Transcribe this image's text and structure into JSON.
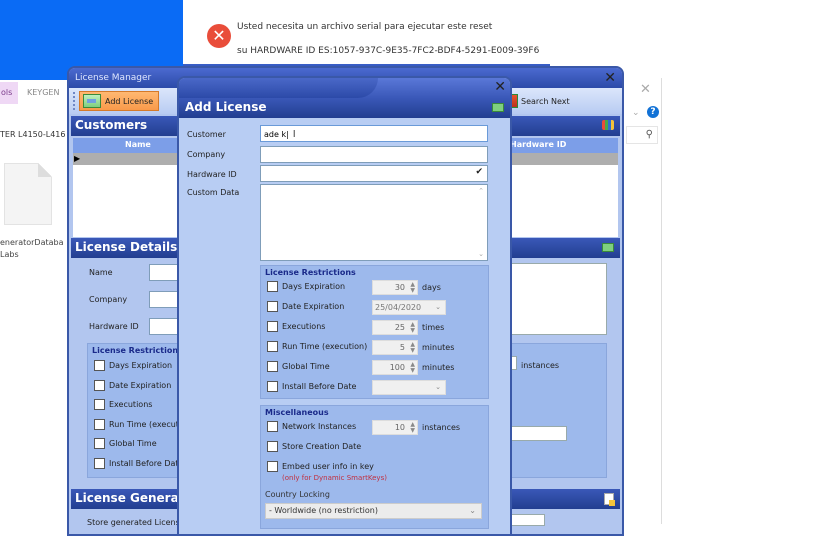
{
  "error_dialog": {
    "line1": "Usted necesita un archivo serial para ejecutar este reset",
    "line2": "su HARDWARE ID ES:1057-937C-9E35-7FC2-BDF4-5291-E009-39F6",
    "icon": "error-icon"
  },
  "explorer": {
    "tab_tools": "ols",
    "tab_keygen": "KEYGEN",
    "address": "TER L4150-L416",
    "file_name_line1": "eneratorDataba",
    "file_name_line2": "Labs"
  },
  "license_manager": {
    "title": "License Manager",
    "toolbar": {
      "add_license": "Add License",
      "search_next": "Search Next"
    },
    "customers": {
      "title": "Customers",
      "columns": [
        "Name",
        "Hardware ID"
      ]
    },
    "license_details": {
      "title": "License Details",
      "fields": [
        "Name",
        "Company",
        "Hardware ID"
      ],
      "restrictions_title": "License Restriction",
      "restrictions": [
        "Days Expiration",
        "Date Expiration",
        "Executions",
        "Run Time (executi",
        "Global Time",
        "Install Before Date"
      ],
      "instances_label": "instances"
    },
    "license_generation": {
      "title": "License Generati",
      "store_label": "Store generated License"
    }
  },
  "add_license": {
    "title": "Add License",
    "fields": {
      "customer_label": "Customer",
      "customer_value": "ade k|",
      "company_label": "Company",
      "company_value": "",
      "hardware_id_label": "Hardware ID",
      "hardware_id_value": "",
      "custom_data_label": "Custom Data",
      "custom_data_value": ""
    },
    "restrictions": {
      "title": "License Restrictions",
      "days_expiration": {
        "label": "Days Expiration",
        "value": "30",
        "unit": "days",
        "checked": false
      },
      "date_expiration": {
        "label": "Date Expiration",
        "value": "25/04/2020",
        "checked": false
      },
      "executions": {
        "label": "Executions",
        "value": "25",
        "unit": "times",
        "checked": false
      },
      "run_time": {
        "label": "Run Time (execution)",
        "value": "5",
        "unit": "minutes",
        "checked": false
      },
      "global_time": {
        "label": "Global Time",
        "value": "100",
        "unit": "minutes",
        "checked": false
      },
      "install_before_date": {
        "label": "Install Before Date",
        "value": "",
        "checked": false
      }
    },
    "miscellaneous": {
      "title": "Miscellaneous",
      "network_instances": {
        "label": "Network Instances",
        "value": "10",
        "unit": "instances",
        "checked": false
      },
      "store_creation_date": {
        "label": "Store Creation Date",
        "checked": false
      },
      "embed_user_info": {
        "label": "Embed user info in key",
        "note": "(only for Dynamic SmartKeys)",
        "checked": false
      },
      "country_locking_label": "Country Locking",
      "country_locking_value": "- Worldwide (no restriction)"
    }
  },
  "colors": {
    "desktop_blue": "#0a6bf5",
    "section_header": "#2c4aa8",
    "panel_bg": "#b8cdf3",
    "group_bg": "#9db9ec",
    "add_license_btn": "#f99a4a",
    "error_red": "#e94d3a",
    "note_red": "#c03040"
  }
}
